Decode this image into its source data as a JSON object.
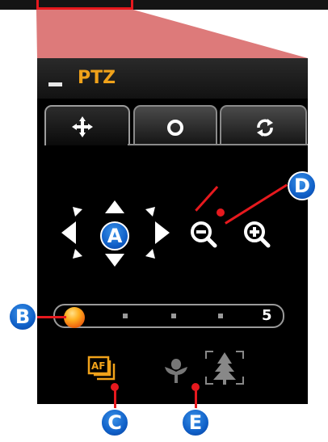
{
  "panel": {
    "title": "PTZ",
    "collapse_icon": "minus-icon",
    "tabs": [
      {
        "id": "move",
        "icon": "move-arrows-icon",
        "active": true
      },
      {
        "id": "preset",
        "icon": "preset-dot-icon",
        "active": false
      },
      {
        "id": "tour",
        "icon": "rotate-icon",
        "active": false
      }
    ]
  },
  "speed_slider": {
    "max_label": "5",
    "value": 1
  },
  "zoom": {
    "out_icon": "zoom-out-icon",
    "in_icon": "zoom-in-icon"
  },
  "focus": {
    "af_icon": "af-icon",
    "near_icon": "flower-icon",
    "far_icon": "tree-icon"
  },
  "callouts": {
    "a": "A",
    "b": "B",
    "c": "C",
    "d": "D",
    "e": "E"
  },
  "colors": {
    "panel_bg": "#000000",
    "title": "#f0a21a",
    "callout": "#1060c8",
    "callout_line": "#e6191e"
  }
}
